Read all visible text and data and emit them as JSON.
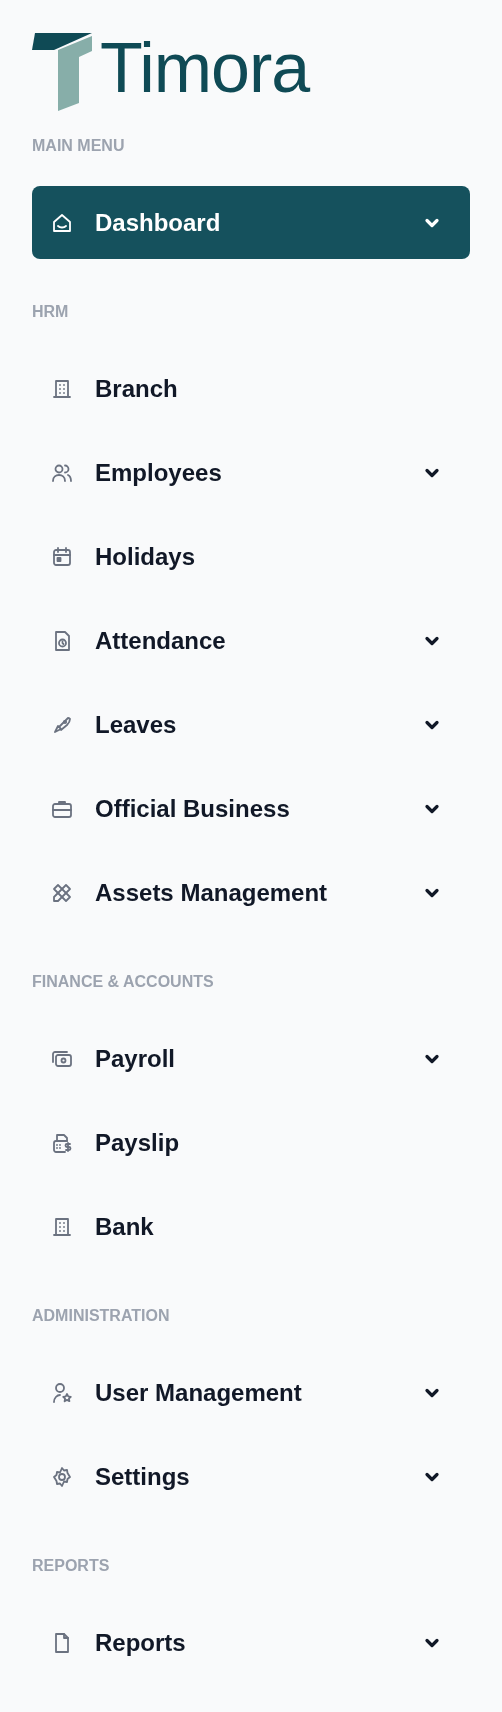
{
  "logo": {
    "text": "Timora"
  },
  "sections": [
    {
      "label": "MAIN MENU",
      "items": [
        {
          "label": "Dashboard",
          "selected": true,
          "expandable": true
        }
      ]
    },
    {
      "label": "HRM",
      "items": [
        {
          "label": "Branch",
          "selected": false,
          "expandable": false
        },
        {
          "label": "Employees",
          "selected": false,
          "expandable": true
        },
        {
          "label": "Holidays",
          "selected": false,
          "expandable": false
        },
        {
          "label": "Attendance",
          "selected": false,
          "expandable": true
        },
        {
          "label": "Leaves",
          "selected": false,
          "expandable": true
        },
        {
          "label": "Official Business",
          "selected": false,
          "expandable": true
        },
        {
          "label": "Assets Management",
          "selected": false,
          "expandable": true
        }
      ]
    },
    {
      "label": "FINANCE & ACCOUNTS",
      "items": [
        {
          "label": "Payroll",
          "selected": false,
          "expandable": true
        },
        {
          "label": "Payslip",
          "selected": false,
          "expandable": false
        },
        {
          "label": "Bank",
          "selected": false,
          "expandable": false
        }
      ]
    },
    {
      "label": "ADMINISTRATION",
      "items": [
        {
          "label": "User Management",
          "selected": false,
          "expandable": true
        },
        {
          "label": "Settings",
          "selected": false,
          "expandable": true
        }
      ]
    },
    {
      "label": "REPORTS",
      "items": [
        {
          "label": "Reports",
          "selected": false,
          "expandable": true
        }
      ]
    }
  ]
}
